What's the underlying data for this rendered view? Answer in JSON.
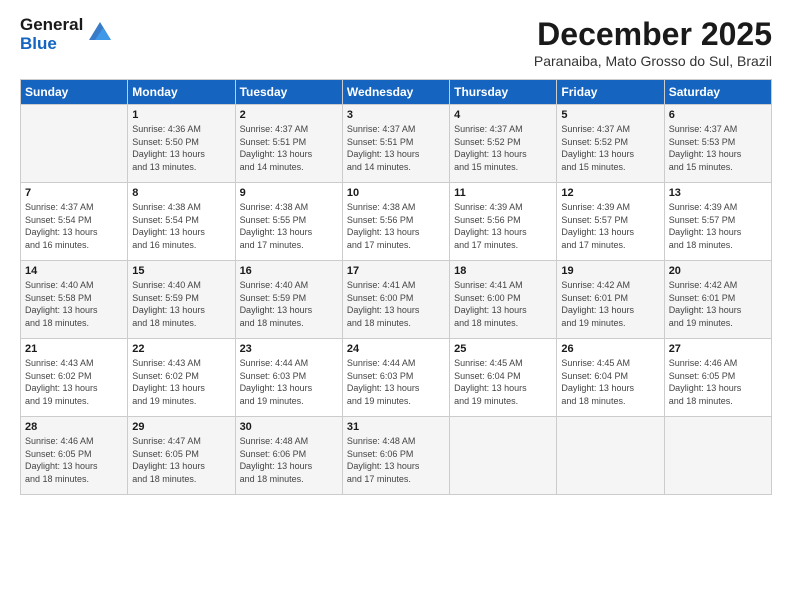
{
  "header": {
    "logo_line1": "General",
    "logo_line2": "Blue",
    "month": "December 2025",
    "location": "Paranaiba, Mato Grosso do Sul, Brazil"
  },
  "weekdays": [
    "Sunday",
    "Monday",
    "Tuesday",
    "Wednesday",
    "Thursday",
    "Friday",
    "Saturday"
  ],
  "weeks": [
    [
      {
        "day": "",
        "info": ""
      },
      {
        "day": "1",
        "info": "Sunrise: 4:36 AM\nSunset: 5:50 PM\nDaylight: 13 hours\nand 13 minutes."
      },
      {
        "day": "2",
        "info": "Sunrise: 4:37 AM\nSunset: 5:51 PM\nDaylight: 13 hours\nand 14 minutes."
      },
      {
        "day": "3",
        "info": "Sunrise: 4:37 AM\nSunset: 5:51 PM\nDaylight: 13 hours\nand 14 minutes."
      },
      {
        "day": "4",
        "info": "Sunrise: 4:37 AM\nSunset: 5:52 PM\nDaylight: 13 hours\nand 15 minutes."
      },
      {
        "day": "5",
        "info": "Sunrise: 4:37 AM\nSunset: 5:52 PM\nDaylight: 13 hours\nand 15 minutes."
      },
      {
        "day": "6",
        "info": "Sunrise: 4:37 AM\nSunset: 5:53 PM\nDaylight: 13 hours\nand 15 minutes."
      }
    ],
    [
      {
        "day": "7",
        "info": "Sunrise: 4:37 AM\nSunset: 5:54 PM\nDaylight: 13 hours\nand 16 minutes."
      },
      {
        "day": "8",
        "info": "Sunrise: 4:38 AM\nSunset: 5:54 PM\nDaylight: 13 hours\nand 16 minutes."
      },
      {
        "day": "9",
        "info": "Sunrise: 4:38 AM\nSunset: 5:55 PM\nDaylight: 13 hours\nand 17 minutes."
      },
      {
        "day": "10",
        "info": "Sunrise: 4:38 AM\nSunset: 5:56 PM\nDaylight: 13 hours\nand 17 minutes."
      },
      {
        "day": "11",
        "info": "Sunrise: 4:39 AM\nSunset: 5:56 PM\nDaylight: 13 hours\nand 17 minutes."
      },
      {
        "day": "12",
        "info": "Sunrise: 4:39 AM\nSunset: 5:57 PM\nDaylight: 13 hours\nand 17 minutes."
      },
      {
        "day": "13",
        "info": "Sunrise: 4:39 AM\nSunset: 5:57 PM\nDaylight: 13 hours\nand 18 minutes."
      }
    ],
    [
      {
        "day": "14",
        "info": "Sunrise: 4:40 AM\nSunset: 5:58 PM\nDaylight: 13 hours\nand 18 minutes."
      },
      {
        "day": "15",
        "info": "Sunrise: 4:40 AM\nSunset: 5:59 PM\nDaylight: 13 hours\nand 18 minutes."
      },
      {
        "day": "16",
        "info": "Sunrise: 4:40 AM\nSunset: 5:59 PM\nDaylight: 13 hours\nand 18 minutes."
      },
      {
        "day": "17",
        "info": "Sunrise: 4:41 AM\nSunset: 6:00 PM\nDaylight: 13 hours\nand 18 minutes."
      },
      {
        "day": "18",
        "info": "Sunrise: 4:41 AM\nSunset: 6:00 PM\nDaylight: 13 hours\nand 18 minutes."
      },
      {
        "day": "19",
        "info": "Sunrise: 4:42 AM\nSunset: 6:01 PM\nDaylight: 13 hours\nand 19 minutes."
      },
      {
        "day": "20",
        "info": "Sunrise: 4:42 AM\nSunset: 6:01 PM\nDaylight: 13 hours\nand 19 minutes."
      }
    ],
    [
      {
        "day": "21",
        "info": "Sunrise: 4:43 AM\nSunset: 6:02 PM\nDaylight: 13 hours\nand 19 minutes."
      },
      {
        "day": "22",
        "info": "Sunrise: 4:43 AM\nSunset: 6:02 PM\nDaylight: 13 hours\nand 19 minutes."
      },
      {
        "day": "23",
        "info": "Sunrise: 4:44 AM\nSunset: 6:03 PM\nDaylight: 13 hours\nand 19 minutes."
      },
      {
        "day": "24",
        "info": "Sunrise: 4:44 AM\nSunset: 6:03 PM\nDaylight: 13 hours\nand 19 minutes."
      },
      {
        "day": "25",
        "info": "Sunrise: 4:45 AM\nSunset: 6:04 PM\nDaylight: 13 hours\nand 19 minutes."
      },
      {
        "day": "26",
        "info": "Sunrise: 4:45 AM\nSunset: 6:04 PM\nDaylight: 13 hours\nand 18 minutes."
      },
      {
        "day": "27",
        "info": "Sunrise: 4:46 AM\nSunset: 6:05 PM\nDaylight: 13 hours\nand 18 minutes."
      }
    ],
    [
      {
        "day": "28",
        "info": "Sunrise: 4:46 AM\nSunset: 6:05 PM\nDaylight: 13 hours\nand 18 minutes."
      },
      {
        "day": "29",
        "info": "Sunrise: 4:47 AM\nSunset: 6:05 PM\nDaylight: 13 hours\nand 18 minutes."
      },
      {
        "day": "30",
        "info": "Sunrise: 4:48 AM\nSunset: 6:06 PM\nDaylight: 13 hours\nand 18 minutes."
      },
      {
        "day": "31",
        "info": "Sunrise: 4:48 AM\nSunset: 6:06 PM\nDaylight: 13 hours\nand 17 minutes."
      },
      {
        "day": "",
        "info": ""
      },
      {
        "day": "",
        "info": ""
      },
      {
        "day": "",
        "info": ""
      }
    ]
  ]
}
